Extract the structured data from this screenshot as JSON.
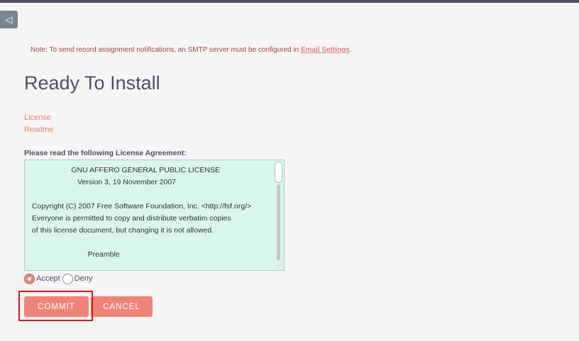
{
  "sidebar_toggle": {
    "icon": "collapse-arrow-icon",
    "glyph": "◁"
  },
  "notice": {
    "text": "Note: To send record assignment notifications, an SMTP server must be configured in ",
    "link_text": "Email Settings",
    "suffix": "."
  },
  "page": {
    "title": "Ready To Install"
  },
  "links": {
    "license": "License",
    "readme": "Readme"
  },
  "license": {
    "label": "Please read the following License Agreement:",
    "text": "                    GNU AFFERO GENERAL PUBLIC LICENSE\n                       Version 3, 19 November 2007\n\n Copyright (C) 2007 Free Software Foundation, Inc. <http://fsf.org/>\n Everyone is permitted to copy and distribute verbatim copies\n of this license document, but changing it is not allowed.\n\n                            Preamble"
  },
  "agreement": {
    "accept_label": "Accept",
    "deny_label": "Deny",
    "selected": "Accept"
  },
  "buttons": {
    "commit": "COMMIT",
    "cancel": "CANCEL"
  },
  "colors": {
    "accent": "#f08377",
    "link": "#e4857c",
    "notice": "#a5423f",
    "title": "#534d64",
    "license_bg": "#d8f5ee",
    "highlight": "#e21212"
  }
}
